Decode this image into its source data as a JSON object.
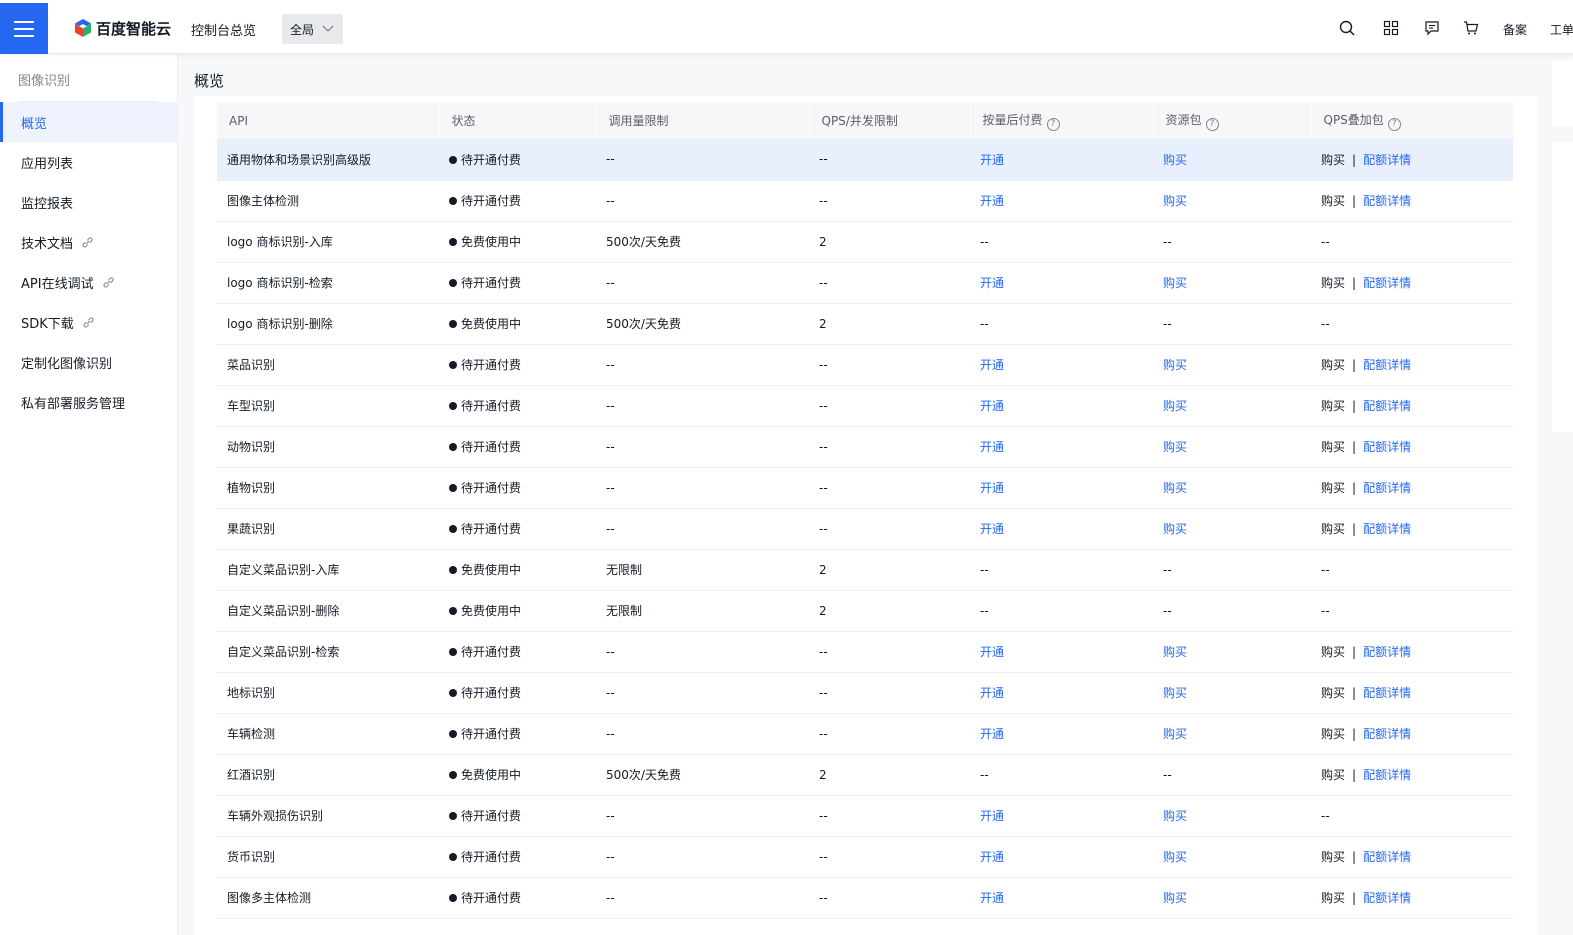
{
  "header": {
    "logo_text": "百度智能云",
    "console_link": "控制台总览",
    "region": "全局",
    "record_link": "备案",
    "ticket_link": "工单"
  },
  "sidebar": {
    "title": "图像识别",
    "items": [
      {
        "label": "概览",
        "active": true,
        "external": false
      },
      {
        "label": "应用列表",
        "active": false,
        "external": false
      },
      {
        "label": "监控报表",
        "active": false,
        "external": false
      },
      {
        "label": "技术文档",
        "active": false,
        "external": true
      },
      {
        "label": "API在线调试",
        "active": false,
        "external": true
      },
      {
        "label": "SDK下载",
        "active": false,
        "external": true
      },
      {
        "label": "定制化图像识别",
        "active": false,
        "external": false
      },
      {
        "label": "私有部署服务管理",
        "active": false,
        "external": false
      }
    ]
  },
  "main": {
    "page_title": "概览",
    "columns": [
      "API",
      "状态",
      "调用量限制",
      "QPS/并发限制",
      "按量后付费",
      "资源包",
      "QPS叠加包"
    ],
    "help_icon": "?",
    "rows": [
      {
        "api": "通用物体和场景识别高级版",
        "status": "待开通付费",
        "limit": "--",
        "qps": "--",
        "postpaid": "开通",
        "package": "购买",
        "qps_buy": "购买",
        "qps_detail": "配额详情",
        "highlight": true
      },
      {
        "api": "图像主体检测",
        "status": "待开通付费",
        "limit": "--",
        "qps": "--",
        "postpaid": "开通",
        "package": "购买",
        "qps_buy": "购买",
        "qps_detail": "配额详情"
      },
      {
        "api": "logo 商标识别-入库",
        "status": "免费使用中",
        "limit": "500次/天免费",
        "qps": "2",
        "postpaid": "--",
        "package": "--",
        "qps_buy": "--",
        "qps_detail": ""
      },
      {
        "api": "logo 商标识别-检索",
        "status": "待开通付费",
        "limit": "--",
        "qps": "--",
        "postpaid": "开通",
        "package": "购买",
        "qps_buy": "购买",
        "qps_detail": "配额详情"
      },
      {
        "api": "logo 商标识别-删除",
        "status": "免费使用中",
        "limit": "500次/天免费",
        "qps": "2",
        "postpaid": "--",
        "package": "--",
        "qps_buy": "--",
        "qps_detail": ""
      },
      {
        "api": "菜品识别",
        "status": "待开通付费",
        "limit": "--",
        "qps": "--",
        "postpaid": "开通",
        "package": "购买",
        "qps_buy": "购买",
        "qps_detail": "配额详情"
      },
      {
        "api": "车型识别",
        "status": "待开通付费",
        "limit": "--",
        "qps": "--",
        "postpaid": "开通",
        "package": "购买",
        "qps_buy": "购买",
        "qps_detail": "配额详情"
      },
      {
        "api": "动物识别",
        "status": "待开通付费",
        "limit": "--",
        "qps": "--",
        "postpaid": "开通",
        "package": "购买",
        "qps_buy": "购买",
        "qps_detail": "配额详情"
      },
      {
        "api": "植物识别",
        "status": "待开通付费",
        "limit": "--",
        "qps": "--",
        "postpaid": "开通",
        "package": "购买",
        "qps_buy": "购买",
        "qps_detail": "配额详情"
      },
      {
        "api": "果蔬识别",
        "status": "待开通付费",
        "limit": "--",
        "qps": "--",
        "postpaid": "开通",
        "package": "购买",
        "qps_buy": "购买",
        "qps_detail": "配额详情"
      },
      {
        "api": "自定义菜品识别-入库",
        "status": "免费使用中",
        "limit": "无限制",
        "qps": "2",
        "postpaid": "--",
        "package": "--",
        "qps_buy": "--",
        "qps_detail": ""
      },
      {
        "api": "自定义菜品识别-删除",
        "status": "免费使用中",
        "limit": "无限制",
        "qps": "2",
        "postpaid": "--",
        "package": "--",
        "qps_buy": "--",
        "qps_detail": ""
      },
      {
        "api": "自定义菜品识别-检索",
        "status": "待开通付费",
        "limit": "--",
        "qps": "--",
        "postpaid": "开通",
        "package": "购买",
        "qps_buy": "购买",
        "qps_detail": "配额详情"
      },
      {
        "api": "地标识别",
        "status": "待开通付费",
        "limit": "--",
        "qps": "--",
        "postpaid": "开通",
        "package": "购买",
        "qps_buy": "购买",
        "qps_detail": "配额详情"
      },
      {
        "api": "车辆检测",
        "status": "待开通付费",
        "limit": "--",
        "qps": "--",
        "postpaid": "开通",
        "package": "购买",
        "qps_buy": "购买",
        "qps_detail": "配额详情"
      },
      {
        "api": "红酒识别",
        "status": "免费使用中",
        "limit": "500次/天免费",
        "qps": "2",
        "postpaid": "--",
        "package": "--",
        "qps_buy": "购买",
        "qps_detail": "配额详情"
      },
      {
        "api": "车辆外观损伤识别",
        "status": "待开通付费",
        "limit": "--",
        "qps": "--",
        "postpaid": "开通",
        "package": "购买",
        "qps_buy": "--",
        "qps_detail": ""
      },
      {
        "api": "货币识别",
        "status": "待开通付费",
        "limit": "--",
        "qps": "--",
        "postpaid": "开通",
        "package": "购买",
        "qps_buy": "购买",
        "qps_detail": "配额详情"
      },
      {
        "api": "图像多主体检测",
        "status": "待开通付费",
        "limit": "--",
        "qps": "--",
        "postpaid": "开通",
        "package": "购买",
        "qps_buy": "购买",
        "qps_detail": "配额详情"
      }
    ]
  }
}
